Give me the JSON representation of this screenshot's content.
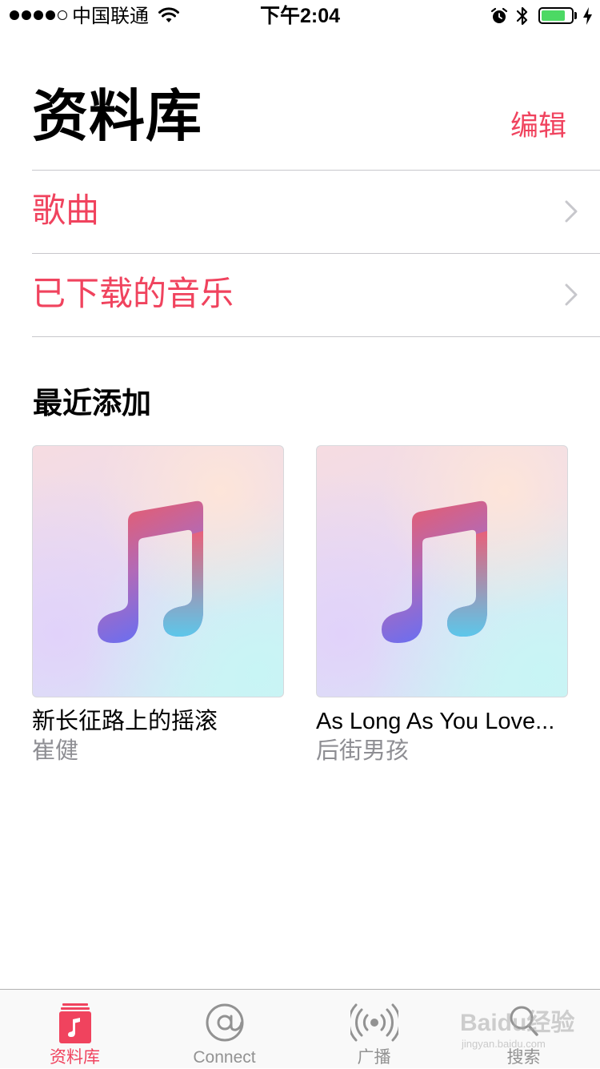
{
  "status_bar": {
    "carrier": "中国联通",
    "time": "下午2:04",
    "signal_bars_filled": 4,
    "signal_bars_total": 5,
    "battery_level": 0.8,
    "icons": [
      "signal-dots",
      "wifi-icon",
      "alarm-icon",
      "bluetooth-icon",
      "battery-icon",
      "charging-icon"
    ]
  },
  "header": {
    "title": "资料库",
    "edit_label": "编辑"
  },
  "categories": [
    {
      "label": "歌曲"
    },
    {
      "label": "已下载的音乐"
    }
  ],
  "recently_added": {
    "title": "最近添加",
    "albums": [
      {
        "title": "新长征路上的摇滚",
        "artist": "崔健",
        "art_icon": "music-note-icon"
      },
      {
        "title": "As Long As You Love...",
        "artist": "后街男孩",
        "art_icon": "music-note-icon"
      }
    ]
  },
  "tab_bar": {
    "active": "library",
    "tabs": [
      {
        "label": "资料库",
        "icon": "library-icon"
      },
      {
        "label": "Connect",
        "icon": "at-sign-icon"
      },
      {
        "label": "广播",
        "icon": "radio-icon"
      },
      {
        "label": "搜索",
        "icon": "search-icon"
      }
    ]
  },
  "watermark": {
    "text": "Baidu经验",
    "sub": "jingyan.baidu.com"
  },
  "colors": {
    "accent": "#f0435e",
    "secondary_text": "#8e8e93",
    "separator": "#c8c7cc",
    "battery_fill": "#4cd964"
  }
}
